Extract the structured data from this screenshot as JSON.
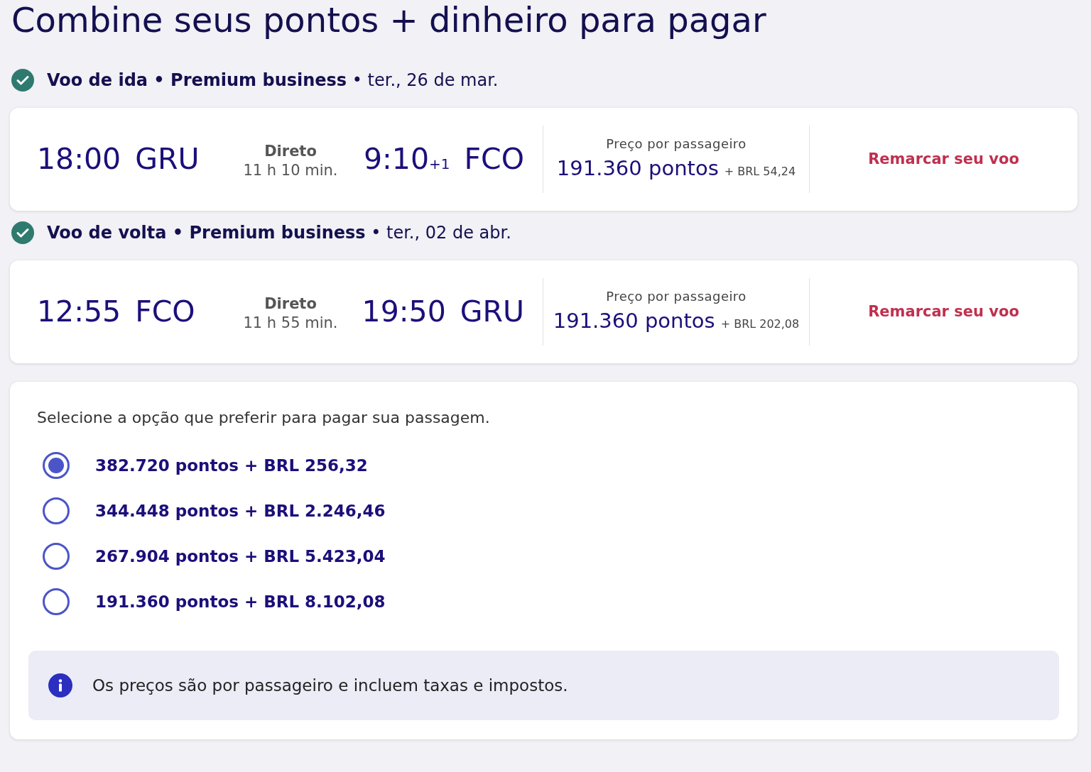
{
  "title": "Combine seus pontos + dinheiro para pagar",
  "flights": [
    {
      "heading": "**Voo de ida • Premium business** • ter., 26 de mar.",
      "departure": {
        "time": "18:00",
        "airport": "GRU"
      },
      "stops": "Direto",
      "duration": "11 h 10 min.",
      "arrival": {
        "time": "9:10",
        "day_offset": "+1",
        "airport": "FCO"
      },
      "price_label": "Preço por passageiro",
      "points": "191.360 pontos",
      "cash": "+ BRL 54,24",
      "action": "Remarcar seu voo"
    },
    {
      "heading": "**Voo de volta • Premium business** • ter., 02 de abr.",
      "departure": {
        "time": "12:55",
        "airport": "FCO"
      },
      "stops": "Direto",
      "duration": "11 h 55 min.",
      "arrival": {
        "time": "19:50",
        "airport": "GRU"
      },
      "price_label": "Preço por passageiro",
      "points": "191.360 pontos",
      "cash": "+ BRL 202,08",
      "action": "Remarcar seu voo"
    }
  ],
  "payment": {
    "prompt": "Selecione a opção que preferir para pagar sua passagem.",
    "options": [
      {
        "label": "382.720 pontos + BRL 256,32",
        "selected": true
      },
      {
        "label": "344.448 pontos + BRL 2.246,46",
        "selected": false
      },
      {
        "label": "267.904 pontos + BRL 5.423,04",
        "selected": false
      },
      {
        "label": "191.360 pontos + BRL 8.102,08",
        "selected": false
      }
    ],
    "note": "Os preços são por passageiro e incluem taxas e impostos."
  }
}
